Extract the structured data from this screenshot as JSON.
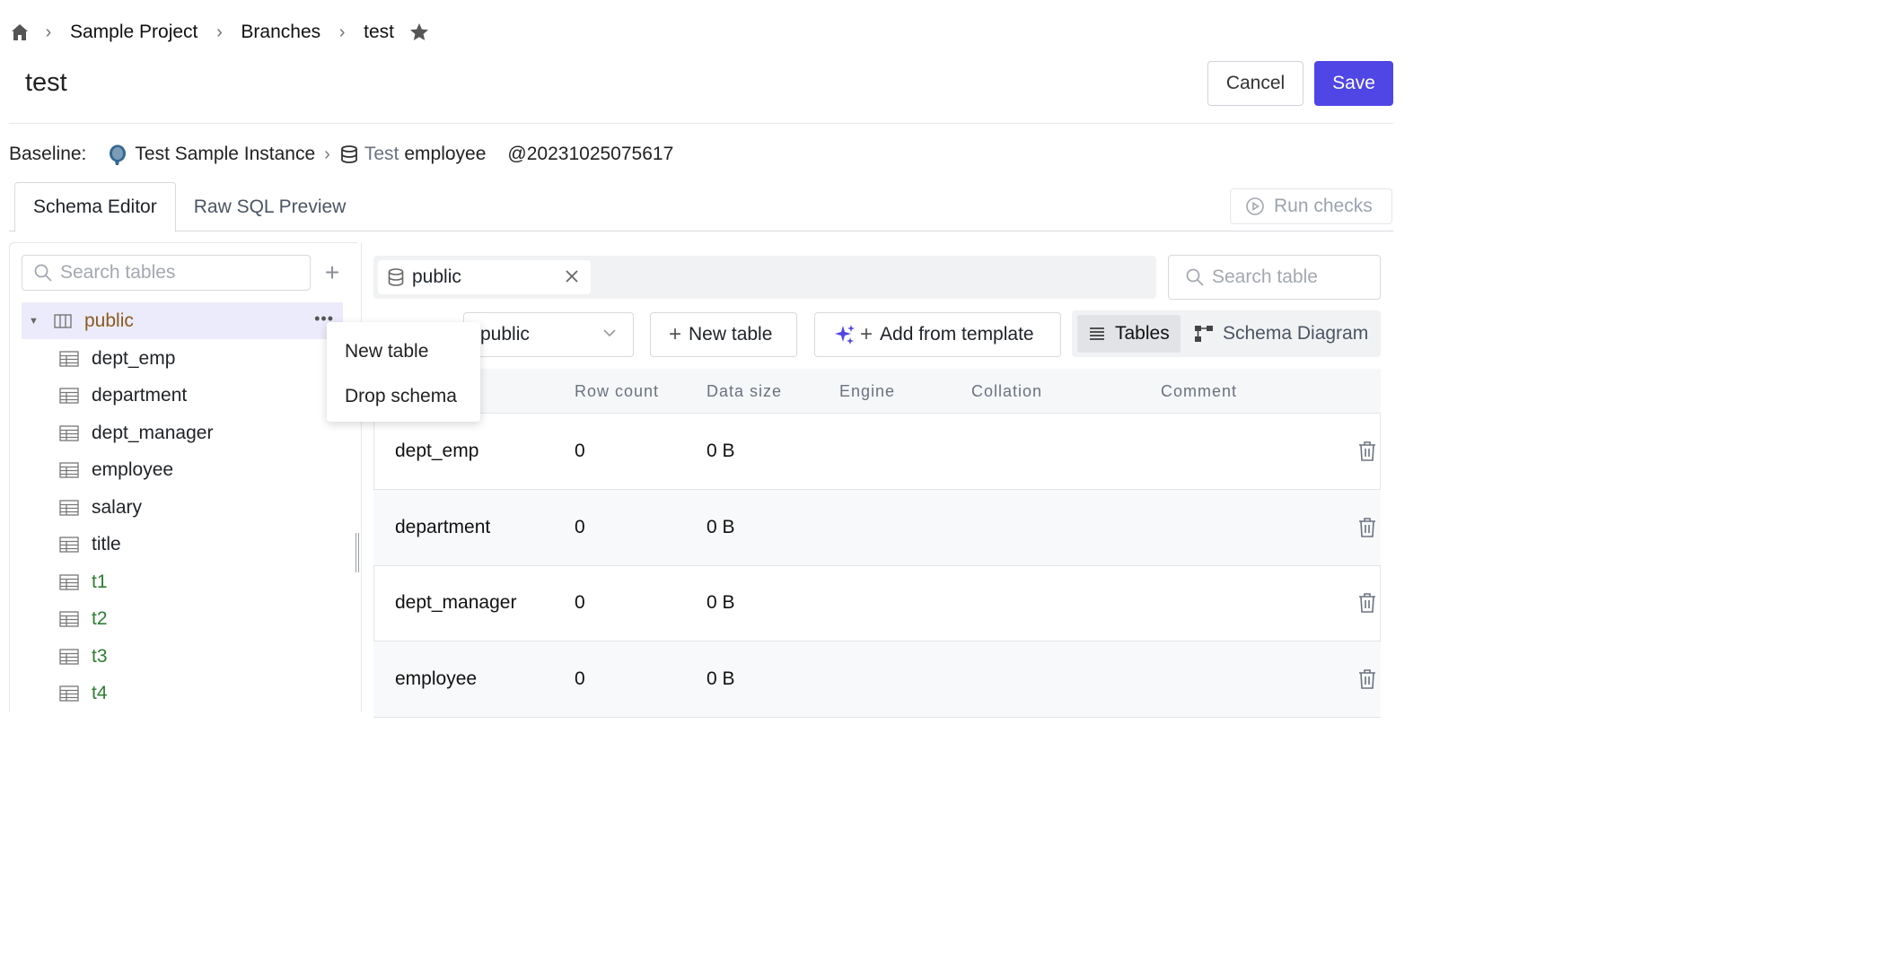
{
  "breadcrumb": {
    "project": "Sample Project",
    "branches": "Branches",
    "current": "test"
  },
  "page": {
    "title": "test"
  },
  "actions": {
    "cancel": "Cancel",
    "save": "Save"
  },
  "baseline": {
    "label": "Baseline:",
    "instance": "Test Sample Instance",
    "environment": "Test",
    "database": "employee",
    "version": "@20231025075617"
  },
  "tabs": [
    {
      "label": "Schema Editor",
      "active": true
    },
    {
      "label": "Raw SQL Preview",
      "active": false
    }
  ],
  "run_checks": "Run checks",
  "sidebar": {
    "search_placeholder": "Search tables",
    "schema": "public",
    "tables": [
      {
        "name": "dept_emp",
        "new": false
      },
      {
        "name": "department",
        "new": false
      },
      {
        "name": "dept_manager",
        "new": false
      },
      {
        "name": "employee",
        "new": false
      },
      {
        "name": "salary",
        "new": false
      },
      {
        "name": "title",
        "new": false
      },
      {
        "name": "t1",
        "new": true
      },
      {
        "name": "t2",
        "new": true
      },
      {
        "name": "t3",
        "new": true
      },
      {
        "name": "t4",
        "new": true
      }
    ]
  },
  "context_menu": {
    "items": [
      "New table",
      "Drop schema"
    ]
  },
  "editor": {
    "schema_tag": "public",
    "search_placeholder": "Search table",
    "schema_select": "public",
    "new_table": "New table",
    "add_template": "Add from template",
    "view_tables": "Tables",
    "view_diagram": "Schema Diagram",
    "columns": [
      "Row count",
      "Data size",
      "Engine",
      "Collation",
      "Comment"
    ],
    "rows": [
      {
        "name": "dept_emp",
        "row_count": "0",
        "data_size": "0 B"
      },
      {
        "name": "department",
        "row_count": "0",
        "data_size": "0 B"
      },
      {
        "name": "dept_manager",
        "row_count": "0",
        "data_size": "0 B"
      },
      {
        "name": "employee",
        "row_count": "0",
        "data_size": "0 B"
      }
    ]
  },
  "colors": {
    "accent": "#4f46e5",
    "new_item": "#2e7d32",
    "schema_name": "#8a5a1c"
  }
}
